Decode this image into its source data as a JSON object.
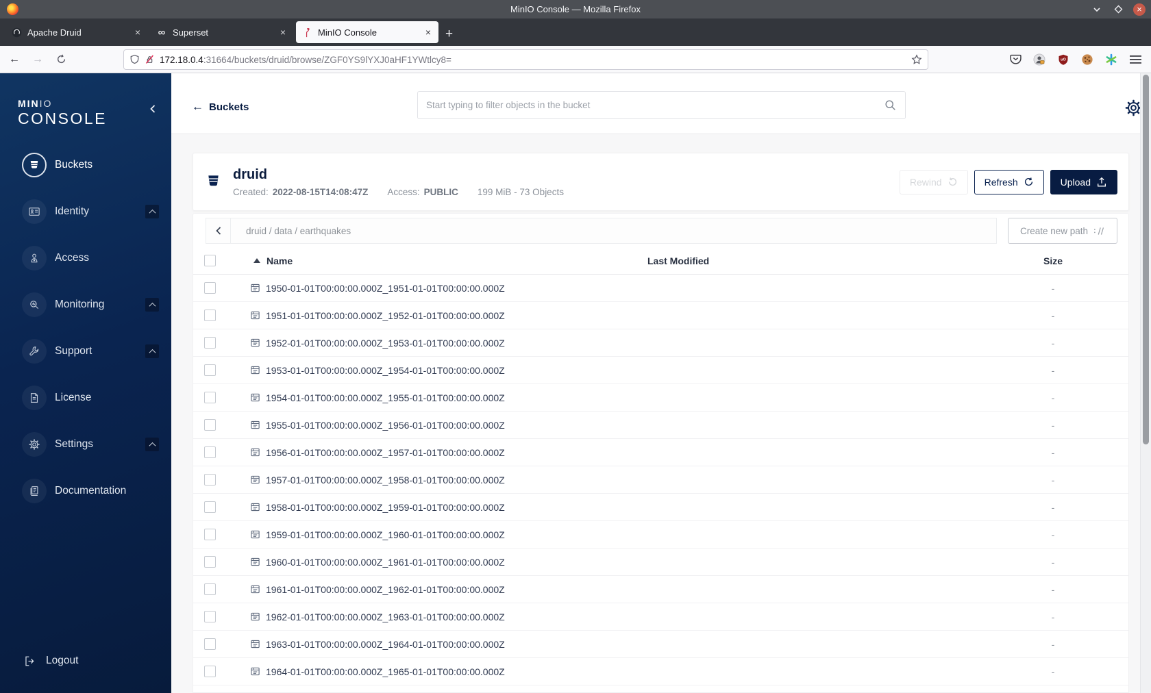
{
  "colors": {
    "navy": "#081c42",
    "minio_red": "#c9334b",
    "close_button": "#c75a4a"
  },
  "titlebar": {
    "title": "MinIO Console — Mozilla Firefox"
  },
  "tabs": [
    {
      "label": "Apache Druid",
      "icon": "druid-favicon",
      "active": false
    },
    {
      "label": "Superset",
      "icon": "superset-favicon",
      "active": false
    },
    {
      "label": "MinIO Console",
      "icon": "minio-flamingo-favicon",
      "active": true
    }
  ],
  "navbar": {
    "url_host": "172.18.0.4",
    "url_rest": ":31664/buckets/druid/browse/ZGF0YS9lYXJ0aHF1YWtlcy8="
  },
  "sidebar": {
    "brand_bold": "MIN",
    "brand_light": "IO",
    "brand_line2": "CONSOLE",
    "items": [
      {
        "label": "Buckets",
        "icon": "buckets-icon",
        "active": true,
        "expandable": false
      },
      {
        "label": "Identity",
        "icon": "identity-icon",
        "active": false,
        "expandable": true
      },
      {
        "label": "Access",
        "icon": "access-icon",
        "active": false,
        "expandable": false
      },
      {
        "label": "Monitoring",
        "icon": "monitoring-icon",
        "active": false,
        "expandable": true
      },
      {
        "label": "Support",
        "icon": "support-icon",
        "active": false,
        "expandable": true
      },
      {
        "label": "License",
        "icon": "license-icon",
        "active": false,
        "expandable": false
      },
      {
        "label": "Settings",
        "icon": "settings-icon",
        "active": false,
        "expandable": true
      },
      {
        "label": "Documentation",
        "icon": "documentation-icon",
        "active": false,
        "expandable": false
      }
    ],
    "logout": {
      "label": "Logout",
      "icon": "logout-icon"
    }
  },
  "header": {
    "back_label": "Buckets",
    "search_placeholder": "Start typing to filter objects in the bucket"
  },
  "bucket": {
    "name": "druid",
    "created_label": "Created:",
    "created_value": "2022-08-15T14:08:47Z",
    "access_label": "Access:",
    "access_value": "PUBLIC",
    "usage_summary": "199 MiB - 73 Objects",
    "actions": {
      "rewind": "Rewind",
      "refresh": "Refresh",
      "upload": "Upload"
    }
  },
  "pathbar": {
    "breadcrumb": "druid / data / earthquakes",
    "create_path_label": "Create new path"
  },
  "table": {
    "headers": {
      "name": "Name",
      "last_modified": "Last Modified",
      "size": "Size"
    },
    "rows": [
      {
        "name": "1950-01-01T00:00:00.000Z_1951-01-01T00:00:00.000Z",
        "size": "-"
      },
      {
        "name": "1951-01-01T00:00:00.000Z_1952-01-01T00:00:00.000Z",
        "size": "-"
      },
      {
        "name": "1952-01-01T00:00:00.000Z_1953-01-01T00:00:00.000Z",
        "size": "-"
      },
      {
        "name": "1953-01-01T00:00:00.000Z_1954-01-01T00:00:00.000Z",
        "size": "-"
      },
      {
        "name": "1954-01-01T00:00:00.000Z_1955-01-01T00:00:00.000Z",
        "size": "-"
      },
      {
        "name": "1955-01-01T00:00:00.000Z_1956-01-01T00:00:00.000Z",
        "size": "-"
      },
      {
        "name": "1956-01-01T00:00:00.000Z_1957-01-01T00:00:00.000Z",
        "size": "-"
      },
      {
        "name": "1957-01-01T00:00:00.000Z_1958-01-01T00:00:00.000Z",
        "size": "-"
      },
      {
        "name": "1958-01-01T00:00:00.000Z_1959-01-01T00:00:00.000Z",
        "size": "-"
      },
      {
        "name": "1959-01-01T00:00:00.000Z_1960-01-01T00:00:00.000Z",
        "size": "-"
      },
      {
        "name": "1960-01-01T00:00:00.000Z_1961-01-01T00:00:00.000Z",
        "size": "-"
      },
      {
        "name": "1961-01-01T00:00:00.000Z_1962-01-01T00:00:00.000Z",
        "size": "-"
      },
      {
        "name": "1962-01-01T00:00:00.000Z_1963-01-01T00:00:00.000Z",
        "size": "-"
      },
      {
        "name": "1963-01-01T00:00:00.000Z_1964-01-01T00:00:00.000Z",
        "size": "-"
      },
      {
        "name": "1964-01-01T00:00:00.000Z_1965-01-01T00:00:00.000Z",
        "size": "-"
      }
    ]
  }
}
